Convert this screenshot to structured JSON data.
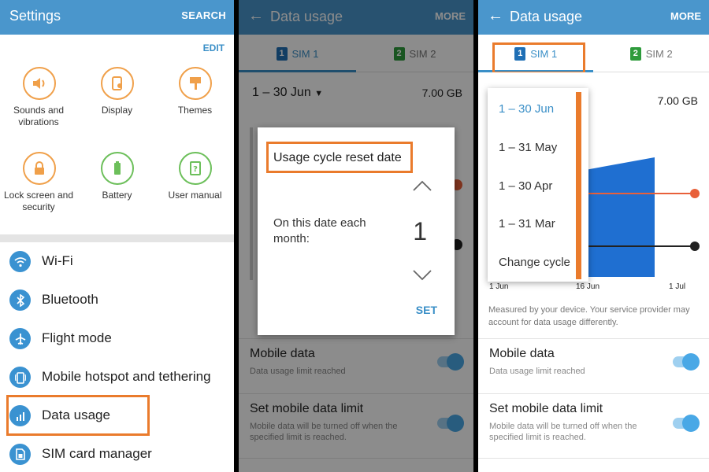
{
  "settings": {
    "title": "Settings",
    "search": "SEARCH",
    "edit": "EDIT",
    "tiles": [
      {
        "label": "Sounds and vibrations",
        "icon": "speaker-icon"
      },
      {
        "label": "Display",
        "icon": "display-icon"
      },
      {
        "label": "Themes",
        "icon": "themes-icon"
      },
      {
        "label": "Lock screen and security",
        "icon": "lock-icon"
      },
      {
        "label": "Battery",
        "icon": "battery-icon"
      },
      {
        "label": "User manual",
        "icon": "user-manual-icon"
      }
    ],
    "list": [
      {
        "label": "Wi-Fi",
        "icon": "wifi-icon"
      },
      {
        "label": "Bluetooth",
        "icon": "bluetooth-icon"
      },
      {
        "label": "Flight mode",
        "icon": "airplane-icon"
      },
      {
        "label": "Mobile hotspot and tethering",
        "icon": "hotspot-icon"
      },
      {
        "label": "Data usage",
        "icon": "data-usage-icon"
      },
      {
        "label": "SIM card manager",
        "icon": "sim-icon"
      }
    ]
  },
  "data_usage": {
    "title": "Data usage",
    "more": "MORE",
    "tabs": [
      {
        "label": "SIM 1",
        "badge": "1"
      },
      {
        "label": "SIM 2",
        "badge": "2"
      }
    ],
    "cycle": "1 – 30 Jun",
    "total": "7.00 GB",
    "dialog": {
      "title": "Usage cycle reset date",
      "text": "On this date each month:",
      "value": "1",
      "set": "SET"
    },
    "dropdown": [
      "1 – 30 Jun",
      "1 – 31 May",
      "1 – 30 Apr",
      "1 – 31 Mar",
      "Change cycle"
    ],
    "axis": [
      "1 Jun",
      "16 Jun",
      "1 Jul"
    ],
    "note": "Measured by your device. Your service provider may account for data usage differently.",
    "mobile_data": {
      "title": "Mobile data",
      "sub": "Data usage limit reached"
    },
    "limit": {
      "title": "Set mobile data limit",
      "sub": "Mobile data will be turned off when the specified limit is reached."
    }
  },
  "colors": {
    "accent": "#4a96cc",
    "highlight": "#ea7b2c",
    "usage_bar": "#1f6fd1",
    "warning_line": "#e8603a"
  }
}
